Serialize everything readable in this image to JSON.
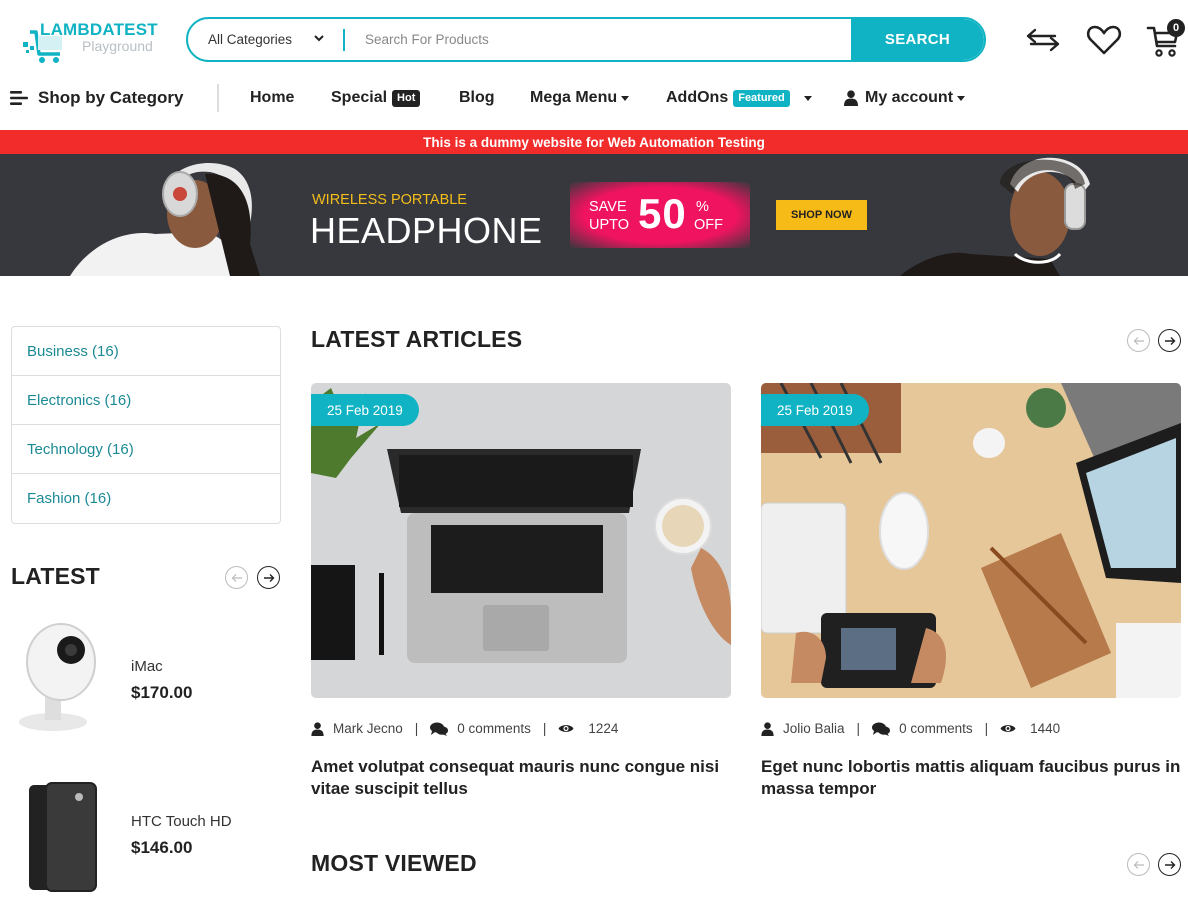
{
  "header": {
    "logo_title": "LAMBDATEST",
    "logo_subtitle": "Playground",
    "search": {
      "category_selected": "All Categories",
      "placeholder": "Search For Products",
      "value": "",
      "button_label": "SEARCH"
    },
    "icons": [
      "compare-icon",
      "wishlist-heart-icon",
      "cart-icon"
    ],
    "cart_count": "0"
  },
  "nav": {
    "shop_by_category": "Shop by Category",
    "items": [
      {
        "label": "Home"
      },
      {
        "label": "Special",
        "badge": "Hot"
      },
      {
        "label": "Blog"
      },
      {
        "label": "Mega Menu",
        "dropdown": true
      },
      {
        "label": "AddOns",
        "badge": "Featured",
        "dropdown": true
      },
      {
        "label": "My account",
        "dropdown": true,
        "icon": "user-icon"
      }
    ]
  },
  "announcement": "This is a dummy website for Web Automation Testing",
  "banner": {
    "subtitle": "WIRELESS PORTABLE",
    "title": "HEADPHONE",
    "save_line1": "SAVE",
    "save_line2": "UPTO",
    "discount": "50",
    "percent": "%",
    "off": "OFF",
    "cta": "SHOP NOW"
  },
  "sidebar": {
    "categories": [
      {
        "label": "Business (16)"
      },
      {
        "label": "Electronics (16)"
      },
      {
        "label": "Technology (16)"
      },
      {
        "label": "Fashion (16)"
      }
    ],
    "latest_title": "LATEST",
    "products": [
      {
        "name": "iMac",
        "price": "$170.00"
      },
      {
        "name": "HTC Touch HD",
        "price": "$146.00"
      }
    ]
  },
  "main": {
    "latest_articles_title": "LATEST ARTICLES",
    "articles": [
      {
        "date": "25 Feb 2019",
        "author": "Mark Jecno",
        "comments": "0 comments",
        "views": "1224",
        "title": "Amet volutpat consequat mauris nunc congue nisi vitae suscipit tellus"
      },
      {
        "date": "25 Feb 2019",
        "author": "Jolio Balia",
        "comments": "0 comments",
        "views": "1440",
        "title": "Eget nunc lobortis mattis aliquam faucibus purus in massa tempor"
      }
    ],
    "most_viewed_title": "MOST VIEWED",
    "separator": "|"
  },
  "colors": {
    "accent": "#10b3c3",
    "announcement_bg": "#f22b2b",
    "banner_bg": "#37383d",
    "banner_pink": "#f0135f",
    "banner_yellow": "#f7bb18",
    "category_link": "#1b8a95"
  }
}
